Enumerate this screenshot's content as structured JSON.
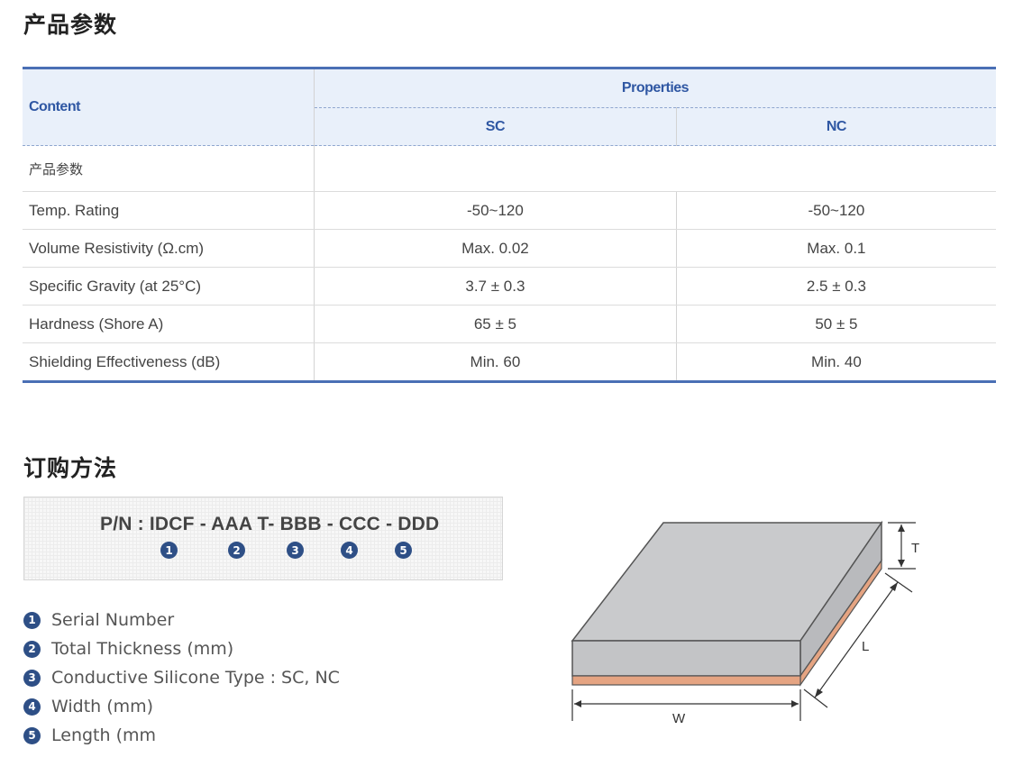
{
  "sections": {
    "specs_title": "产品参数",
    "order_title": "订购方法"
  },
  "table": {
    "content_header": "Content",
    "properties_header": "Properties",
    "sc_header": "SC",
    "nc_header": "NC",
    "group_label": "产品参数",
    "rows": [
      {
        "label": "Temp. Rating",
        "sc": "-50~120",
        "nc": "-50~120"
      },
      {
        "label": "Volume Resistivity (Ω.cm)",
        "sc": "Max. 0.02",
        "nc": "Max. 0.1"
      },
      {
        "label": "Specific Gravity (at 25°C)",
        "sc": "3.7 ± 0.3",
        "nc": "2.5 ± 0.3"
      },
      {
        "label": "Hardness (Shore A)",
        "sc": "65 ± 5",
        "nc": "50 ± 5"
      },
      {
        "label": "Shielding Effectiveness (dB)",
        "sc": "Min. 60",
        "nc": "Min. 40"
      }
    ]
  },
  "part_number": {
    "text": "P/N : IDCF - AAA T- BBB - CCC - DDD",
    "badges": [
      "1",
      "2",
      "3",
      "4",
      "5"
    ]
  },
  "legend": [
    {
      "num": "1",
      "text": "Serial Number"
    },
    {
      "num": "2",
      "text": "Total Thickness (mm)"
    },
    {
      "num": "3",
      "text": "Conductive Silicone Type : SC, NC"
    },
    {
      "num": "4",
      "text": "Width (mm)"
    },
    {
      "num": "5",
      "text": "Length (mm"
    }
  ],
  "diagram": {
    "label_t": "T",
    "label_l": "L",
    "label_w": "W",
    "colors": {
      "top_face": "#c9cacc",
      "copper": "#e5a482",
      "stroke": "#555555"
    }
  },
  "colors": {
    "accent": "#4a6fb5",
    "header_bg": "#e9f0fa",
    "badge": "#2e4f86"
  }
}
